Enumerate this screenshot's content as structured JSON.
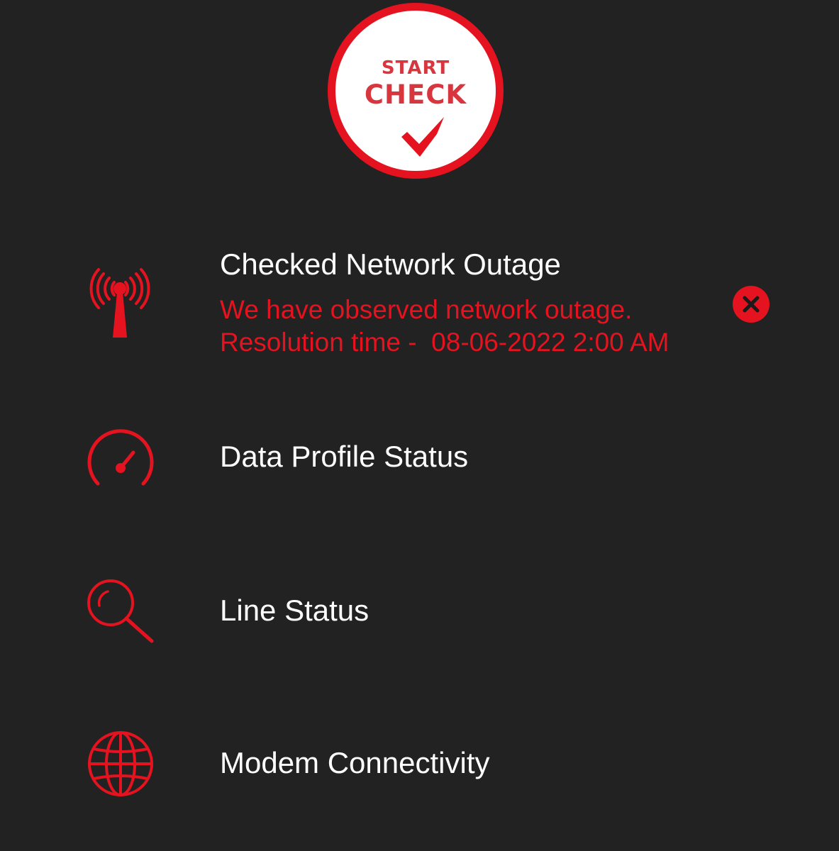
{
  "start_button": {
    "line1": "START",
    "line2": "CHECK",
    "icon": "checkmark-icon"
  },
  "checks": [
    {
      "icon": "antenna-tower-icon",
      "title": "Checked Network Outage",
      "message_line1": "We have observed network outage.",
      "message_line2": "Resolution time -  08-06-2022 2:00 AM",
      "status_icon": "error-x-icon"
    },
    {
      "icon": "speedometer-icon",
      "title": "Data Profile Status"
    },
    {
      "icon": "search-icon",
      "title": "Line Status"
    },
    {
      "icon": "globe-icon",
      "title": "Modem Connectivity"
    }
  ],
  "colors": {
    "background": "#222222",
    "accent_red": "#e5131f",
    "text_white": "#ffffff"
  }
}
